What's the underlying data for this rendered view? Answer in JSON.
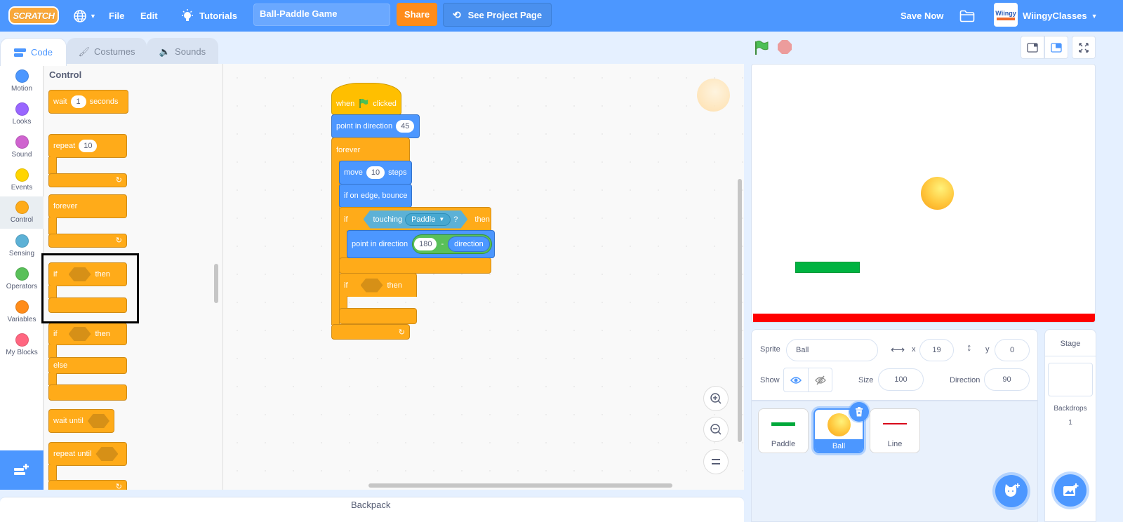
{
  "menubar": {
    "logo": "SCRATCH",
    "file": "File",
    "edit": "Edit",
    "tutorials": "Tutorials",
    "project_title": "Ball-Paddle Game",
    "share": "Share",
    "see_project_page": "See Project Page",
    "save_now": "Save Now",
    "avatar_text": "Wiingy",
    "username": "WiingyClasses"
  },
  "tabs": [
    {
      "label": "Code",
      "active": true
    },
    {
      "label": "Costumes",
      "active": false
    },
    {
      "label": "Sounds",
      "active": false
    }
  ],
  "categories": [
    {
      "label": "Motion",
      "color": "#4c97ff"
    },
    {
      "label": "Looks",
      "color": "#9966ff"
    },
    {
      "label": "Sound",
      "color": "#cf63cf"
    },
    {
      "label": "Events",
      "color": "#ffd500"
    },
    {
      "label": "Control",
      "color": "#ffab19",
      "selected": true
    },
    {
      "label": "Sensing",
      "color": "#5cb1d6"
    },
    {
      "label": "Operators",
      "color": "#59c059"
    },
    {
      "label": "Variables",
      "color": "#ff8c1a"
    },
    {
      "label": "My Blocks",
      "color": "#ff6680"
    }
  ],
  "palette": {
    "title": "Control",
    "blocks": {
      "wait": "wait",
      "wait_value": "1",
      "wait_unit": "seconds",
      "repeat": "repeat",
      "repeat_value": "10",
      "forever": "forever",
      "if": "if",
      "then": "then",
      "if2": "if",
      "then2": "then",
      "else": "else",
      "wait_until": "wait until",
      "repeat_until": "repeat until"
    }
  },
  "script": {
    "hat": {
      "when": "when",
      "clicked": "clicked"
    },
    "point1": {
      "label": "point in direction",
      "value": "45"
    },
    "forever": "forever",
    "move": {
      "label": "move",
      "value": "10",
      "unit": "steps"
    },
    "bounce": "if on edge, bounce",
    "if1": {
      "if": "if",
      "touching": "touching",
      "target": "Paddle",
      "q": "?",
      "then": "then"
    },
    "point2": {
      "label": "point in direction",
      "left": "180",
      "op": "-",
      "right": "direction"
    },
    "if2": {
      "if": "if",
      "then": "then"
    }
  },
  "backpack": "Backpack",
  "sprite_info": {
    "sprite_label": "Sprite",
    "sprite_name": "Ball",
    "x_label": "x",
    "x_value": "19",
    "y_label": "y",
    "y_value": "0",
    "show_label": "Show",
    "size_label": "Size",
    "size_value": "100",
    "direction_label": "Direction",
    "direction_value": "90"
  },
  "sprites": [
    {
      "name": "Paddle",
      "selected": false
    },
    {
      "name": "Ball",
      "selected": true
    },
    {
      "name": "Line",
      "selected": false
    }
  ],
  "stage_panel": {
    "title": "Stage",
    "backdrops_label": "Backdrops",
    "backdrops_count": "1"
  },
  "colors": {
    "accent": "#4c97ff",
    "control": "#ffab19",
    "motion": "#4c97ff",
    "sensing": "#5cb1d6",
    "operators": "#59c059",
    "share": "#ff8c1a",
    "paddle": "#00b341",
    "line": "#ff0000"
  }
}
